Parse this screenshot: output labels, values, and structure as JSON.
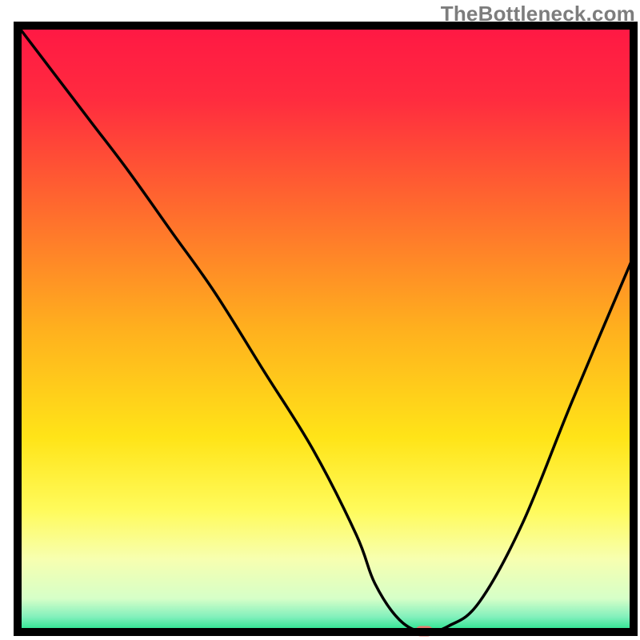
{
  "watermark": "TheBottleneck.com",
  "chart_data": {
    "type": "line",
    "title": "",
    "xlabel": "",
    "ylabel": "",
    "xlim": [
      0,
      100
    ],
    "ylim": [
      0,
      100
    ],
    "x": [
      0,
      6,
      12,
      18,
      25,
      32,
      40,
      48,
      55,
      58,
      62,
      66,
      70,
      75,
      82,
      90,
      100
    ],
    "values": [
      100,
      92,
      84,
      76,
      66,
      56,
      43,
      30,
      16,
      8,
      2,
      0,
      1,
      5,
      18,
      38,
      62
    ],
    "marker": {
      "x": 66,
      "y": 0,
      "color": "#e77d70"
    },
    "gradient_stops": [
      {
        "pos": 0.0,
        "color": "#ff1844"
      },
      {
        "pos": 0.12,
        "color": "#ff2b3f"
      },
      {
        "pos": 0.3,
        "color": "#ff6a2e"
      },
      {
        "pos": 0.5,
        "color": "#ffb01e"
      },
      {
        "pos": 0.68,
        "color": "#ffe418"
      },
      {
        "pos": 0.8,
        "color": "#fffb5c"
      },
      {
        "pos": 0.88,
        "color": "#f7ffb0"
      },
      {
        "pos": 0.945,
        "color": "#d6ffc8"
      },
      {
        "pos": 0.975,
        "color": "#82f0bc"
      },
      {
        "pos": 1.0,
        "color": "#1de389"
      }
    ],
    "frame_color": "#000000",
    "line_color": "#000000"
  }
}
